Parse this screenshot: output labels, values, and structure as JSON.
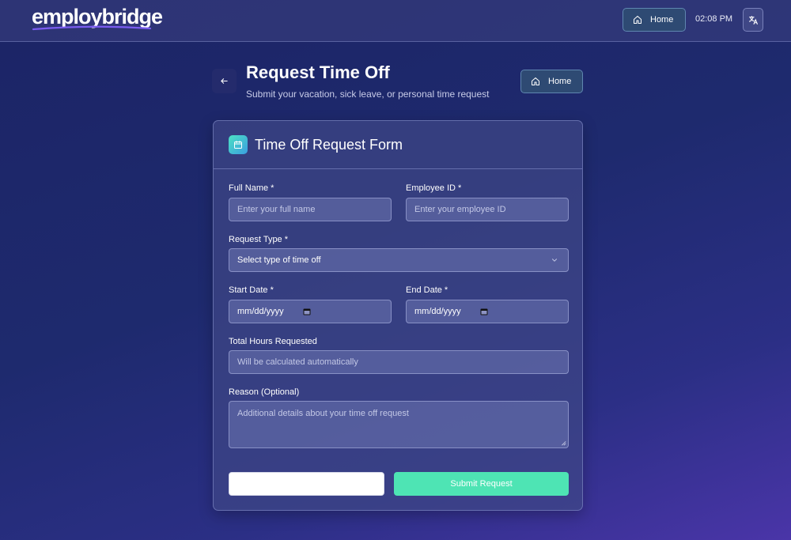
{
  "header": {
    "logo_text": "employbridge",
    "home_label": "Home",
    "time": "02:08 PM",
    "translate_icon": "translate-icon"
  },
  "page": {
    "title": "Request Time Off",
    "subtitle": "Submit your vacation, sick leave, or personal time request",
    "home_label": "Home"
  },
  "form": {
    "title": "Time Off Request Form",
    "full_name": {
      "label": "Full Name *",
      "placeholder": "Enter your full name",
      "value": ""
    },
    "employee_id": {
      "label": "Employee ID *",
      "placeholder": "Enter your employee ID",
      "value": ""
    },
    "request_type": {
      "label": "Request Type *",
      "selected": "Select type of time off"
    },
    "start_date": {
      "label": "Start Date *",
      "value": "mm/dd/yyyy"
    },
    "end_date": {
      "label": "End Date *",
      "value": "mm/dd/yyyy"
    },
    "total_hours": {
      "label": "Total Hours Requested",
      "placeholder": "Will be calculated automatically"
    },
    "reason": {
      "label": "Reason (Optional)",
      "placeholder": "Additional details about your time off request"
    },
    "cancel_label": "",
    "submit_label": "Submit Request"
  },
  "colors": {
    "accent": "#4ee4b4",
    "home_button": "#2e4a73",
    "background_start": "#1c2466",
    "background_end": "#4a35a8"
  }
}
